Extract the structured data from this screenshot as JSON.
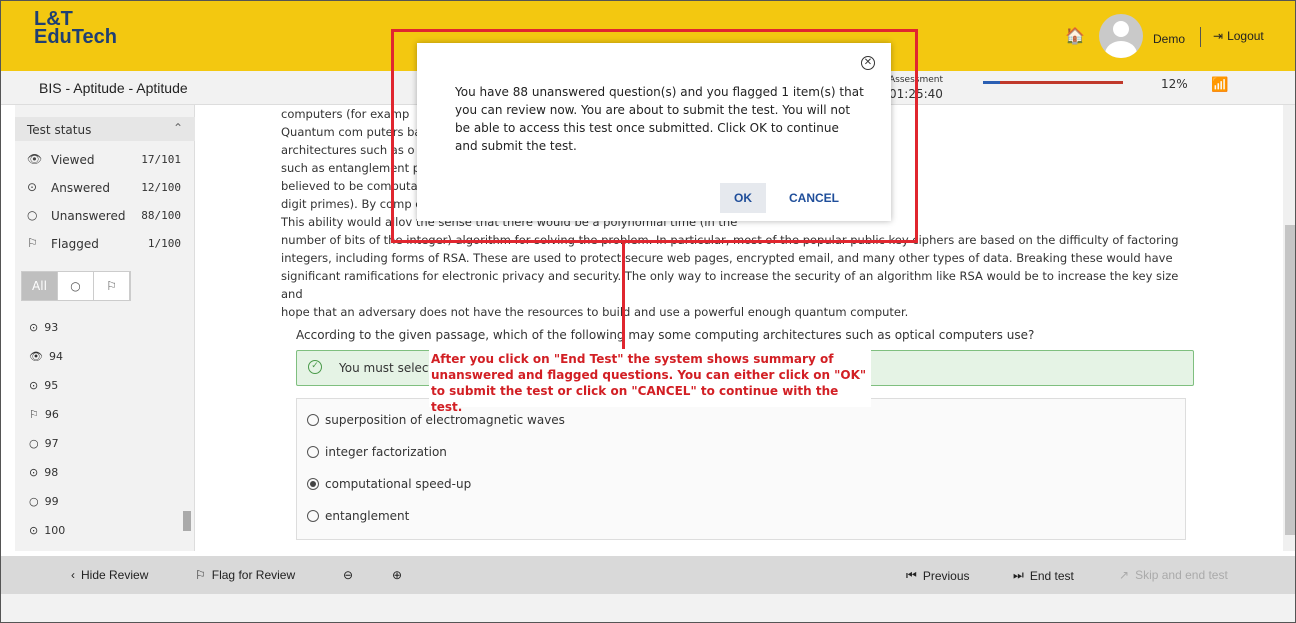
{
  "header": {
    "logo_line1": "L&T",
    "logo_line2": "EduTech",
    "home_icon": "🏠",
    "user_name": "Demo",
    "logout_label": "Logout"
  },
  "subheader": {
    "title": "BIS - Aptitude - Aptitude",
    "assessment_label": "Assessment",
    "timer": "01:25:40",
    "progress_percent": 12,
    "progress_label": "12%"
  },
  "sidebar": {
    "status_title": "Test status",
    "rows": [
      {
        "label": "Viewed",
        "value": "17/101",
        "icon": "👁"
      },
      {
        "label": "Answered",
        "value": "12/100",
        "icon": "⊙"
      },
      {
        "label": "Unanswered",
        "value": "88/100",
        "icon": "○"
      },
      {
        "label": "Flagged",
        "value": "1/100",
        "icon": "⚐"
      }
    ],
    "filter_tabs": [
      "All",
      "○",
      "⚐"
    ],
    "questions": [
      {
        "num": "93",
        "icon": "⊙"
      },
      {
        "num": "94",
        "icon": "👁"
      },
      {
        "num": "95",
        "icon": "⊙"
      },
      {
        "num": "96",
        "icon": "⚐"
      },
      {
        "num": "97",
        "icon": "○"
      },
      {
        "num": "98",
        "icon": "⊙"
      },
      {
        "num": "99",
        "icon": "○"
      },
      {
        "num": "100",
        "icon": "⊙"
      }
    ]
  },
  "passage": {
    "lines": [
      "computers (for examp",
      "        Quantum com                                                                                                                  puters based on transistors. Some computing",
      "architectures such as o                                                                                                             but some specifically quantum mechanical resources",
      "such as entanglement                                                                                                                 power of quantum computers Integer factorization is",
      "believed to be computa                                                                                                               of only a few prime numbers (e.g., products of two 300-",
      "digit primes). By comp                                                                                                               computer using Shor's algorithm to find its factors.",
      "This ability would allov                                                                                                            the sense that there would be a polynomial time (in the",
      "number of bits of the integer) algorithm for solving the problem. In particular, most of the popular public key ciphers are based on the difficulty of factoring",
      "integers, including forms of RSA. These are used to protect secure web pages, encrypted email, and many other types of data. Breaking these would have",
      "significant ramifications for electronic privacy and security. The only way to increase the security of an algorithm like RSA would be to increase the key size and",
      "hope that an adversary does not have the resources to build and use a powerful enough quantum computer."
    ]
  },
  "question": {
    "text": "According to the given passage, which of the following may some computing architectures such as optical computers use?",
    "alert": "You must select a",
    "options": [
      {
        "label": "superposition of electromagnetic waves",
        "selected": false
      },
      {
        "label": "integer factorization",
        "selected": false
      },
      {
        "label": "computational speed-up",
        "selected": true
      },
      {
        "label": "entanglement",
        "selected": false
      }
    ]
  },
  "bottom": {
    "hide_review": "Hide Review",
    "flag_review": "Flag for Review",
    "previous": "Previous",
    "end_test": "End test",
    "skip_end": "Skip and end test"
  },
  "dialog": {
    "message": "You have 88 unanswered question(s) and you flagged 1 item(s) that you can review now. You are about to submit the test. You will not be able to access this test once submitted. Click OK to continue and submit the test.",
    "ok_label": "OK",
    "cancel_label": "CANCEL"
  },
  "callout": {
    "text": "After you click on \"End Test\" the system shows summary of unanswered and flagged questions. You can either click on \"OK\" to submit the test or click on \"CANCEL\" to continue with the test."
  },
  "colors": {
    "header": "#f3c810",
    "highlight": "#e0262f",
    "accent": "#1f4e9a"
  }
}
